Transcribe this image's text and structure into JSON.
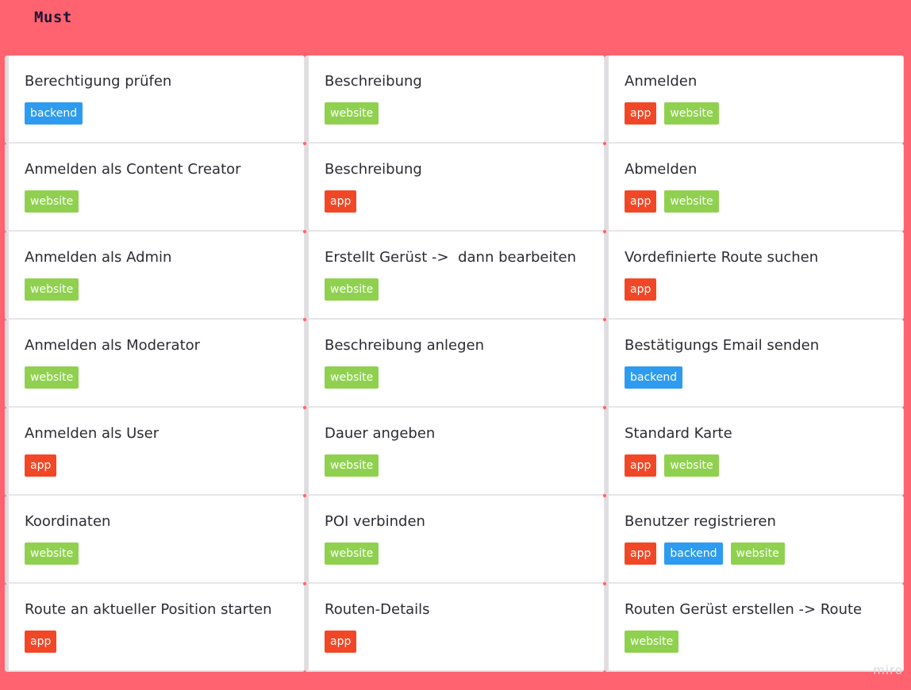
{
  "frame": {
    "title": "Must"
  },
  "colors": {
    "background": "#ff6370",
    "tag_app": "#f24726",
    "tag_backend": "#2d9bf0",
    "tag_website": "#8fd14f"
  },
  "cards": [
    {
      "title": "Berechtigung prüfen",
      "tags": [
        "backend"
      ]
    },
    {
      "title": "Beschreibung",
      "tags": [
        "website"
      ]
    },
    {
      "title": "Anmelden",
      "tags": [
        "app",
        "website"
      ]
    },
    {
      "title": "Anmelden als Content Creator",
      "tags": [
        "website"
      ]
    },
    {
      "title": "Beschreibung",
      "tags": [
        "app"
      ]
    },
    {
      "title": "Abmelden",
      "tags": [
        "app",
        "website"
      ]
    },
    {
      "title": "Anmelden als Admin",
      "tags": [
        "website"
      ]
    },
    {
      "title": "Erstellt Gerüst ->  dann bearbeiten",
      "tags": [
        "website"
      ]
    },
    {
      "title": "Vordefinierte Route suchen",
      "tags": [
        "app"
      ]
    },
    {
      "title": "Anmelden als Moderator",
      "tags": [
        "website"
      ]
    },
    {
      "title": "Beschreibung anlegen",
      "tags": [
        "website"
      ]
    },
    {
      "title": "Bestätigungs Email senden",
      "tags": [
        "backend"
      ]
    },
    {
      "title": "Anmelden als User",
      "tags": [
        "app"
      ]
    },
    {
      "title": "Dauer angeben",
      "tags": [
        "website"
      ]
    },
    {
      "title": "Standard Karte",
      "tags": [
        "app",
        "website"
      ]
    },
    {
      "title": "Koordinaten",
      "tags": [
        "website"
      ]
    },
    {
      "title": "POI verbinden",
      "tags": [
        "website"
      ]
    },
    {
      "title": "Benutzer registrieren",
      "tags": [
        "app",
        "backend",
        "website"
      ]
    },
    {
      "title": "Route an aktueller Position starten",
      "tags": [
        "app"
      ]
    },
    {
      "title": "Routen-Details",
      "tags": [
        "app"
      ]
    },
    {
      "title": "Routen Gerüst erstellen -> Route",
      "tags": [
        "website"
      ]
    }
  ],
  "watermark": "miro"
}
